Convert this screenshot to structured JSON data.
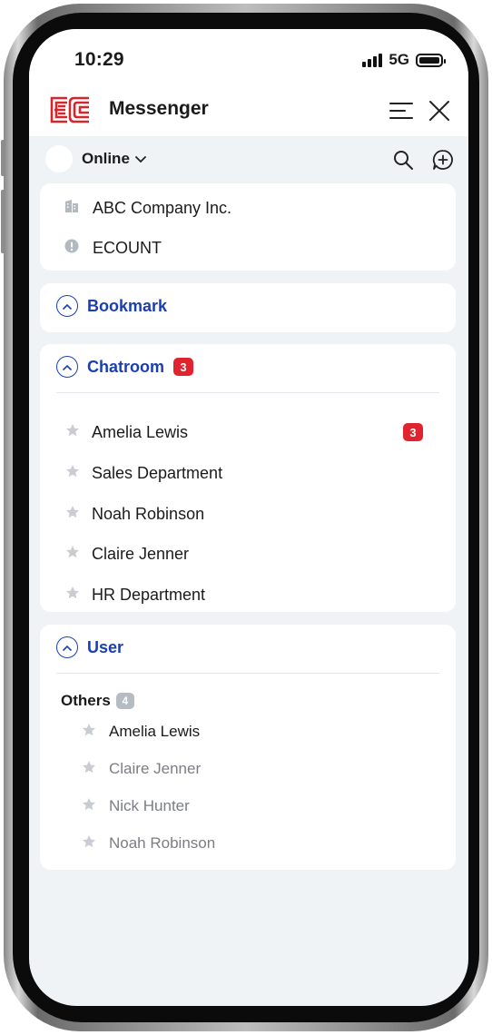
{
  "status_bar": {
    "time": "10:29",
    "network": "5G"
  },
  "app": {
    "title": "Messenger",
    "logo": "EC"
  },
  "presence": {
    "status": "Online"
  },
  "companies": [
    {
      "icon": "building-icon",
      "label": "ABC Company Inc."
    },
    {
      "icon": "info-icon",
      "label": "ECOUNT"
    }
  ],
  "bookmark": {
    "title": "Bookmark"
  },
  "chatroom": {
    "title": "Chatroom",
    "badge": "3",
    "items": [
      {
        "name": "Amelia Lewis",
        "unread": "3"
      },
      {
        "name": "Sales Department",
        "unread": ""
      },
      {
        "name": "Noah Robinson",
        "unread": ""
      },
      {
        "name": "Claire Jenner",
        "unread": ""
      },
      {
        "name": "HR Department",
        "unread": ""
      }
    ]
  },
  "user": {
    "title": "User",
    "group": {
      "label": "Others",
      "count": "4"
    },
    "items": [
      {
        "name": "Amelia Lewis",
        "online": true
      },
      {
        "name": "Claire Jenner",
        "online": false
      },
      {
        "name": "Nick Hunter",
        "online": false
      },
      {
        "name": "Noah Robinson",
        "online": false
      }
    ]
  },
  "colors": {
    "accent": "#1a3fb3",
    "badge": "#e0232e",
    "logo": "#d7262b",
    "background": "#f0f3f6"
  }
}
